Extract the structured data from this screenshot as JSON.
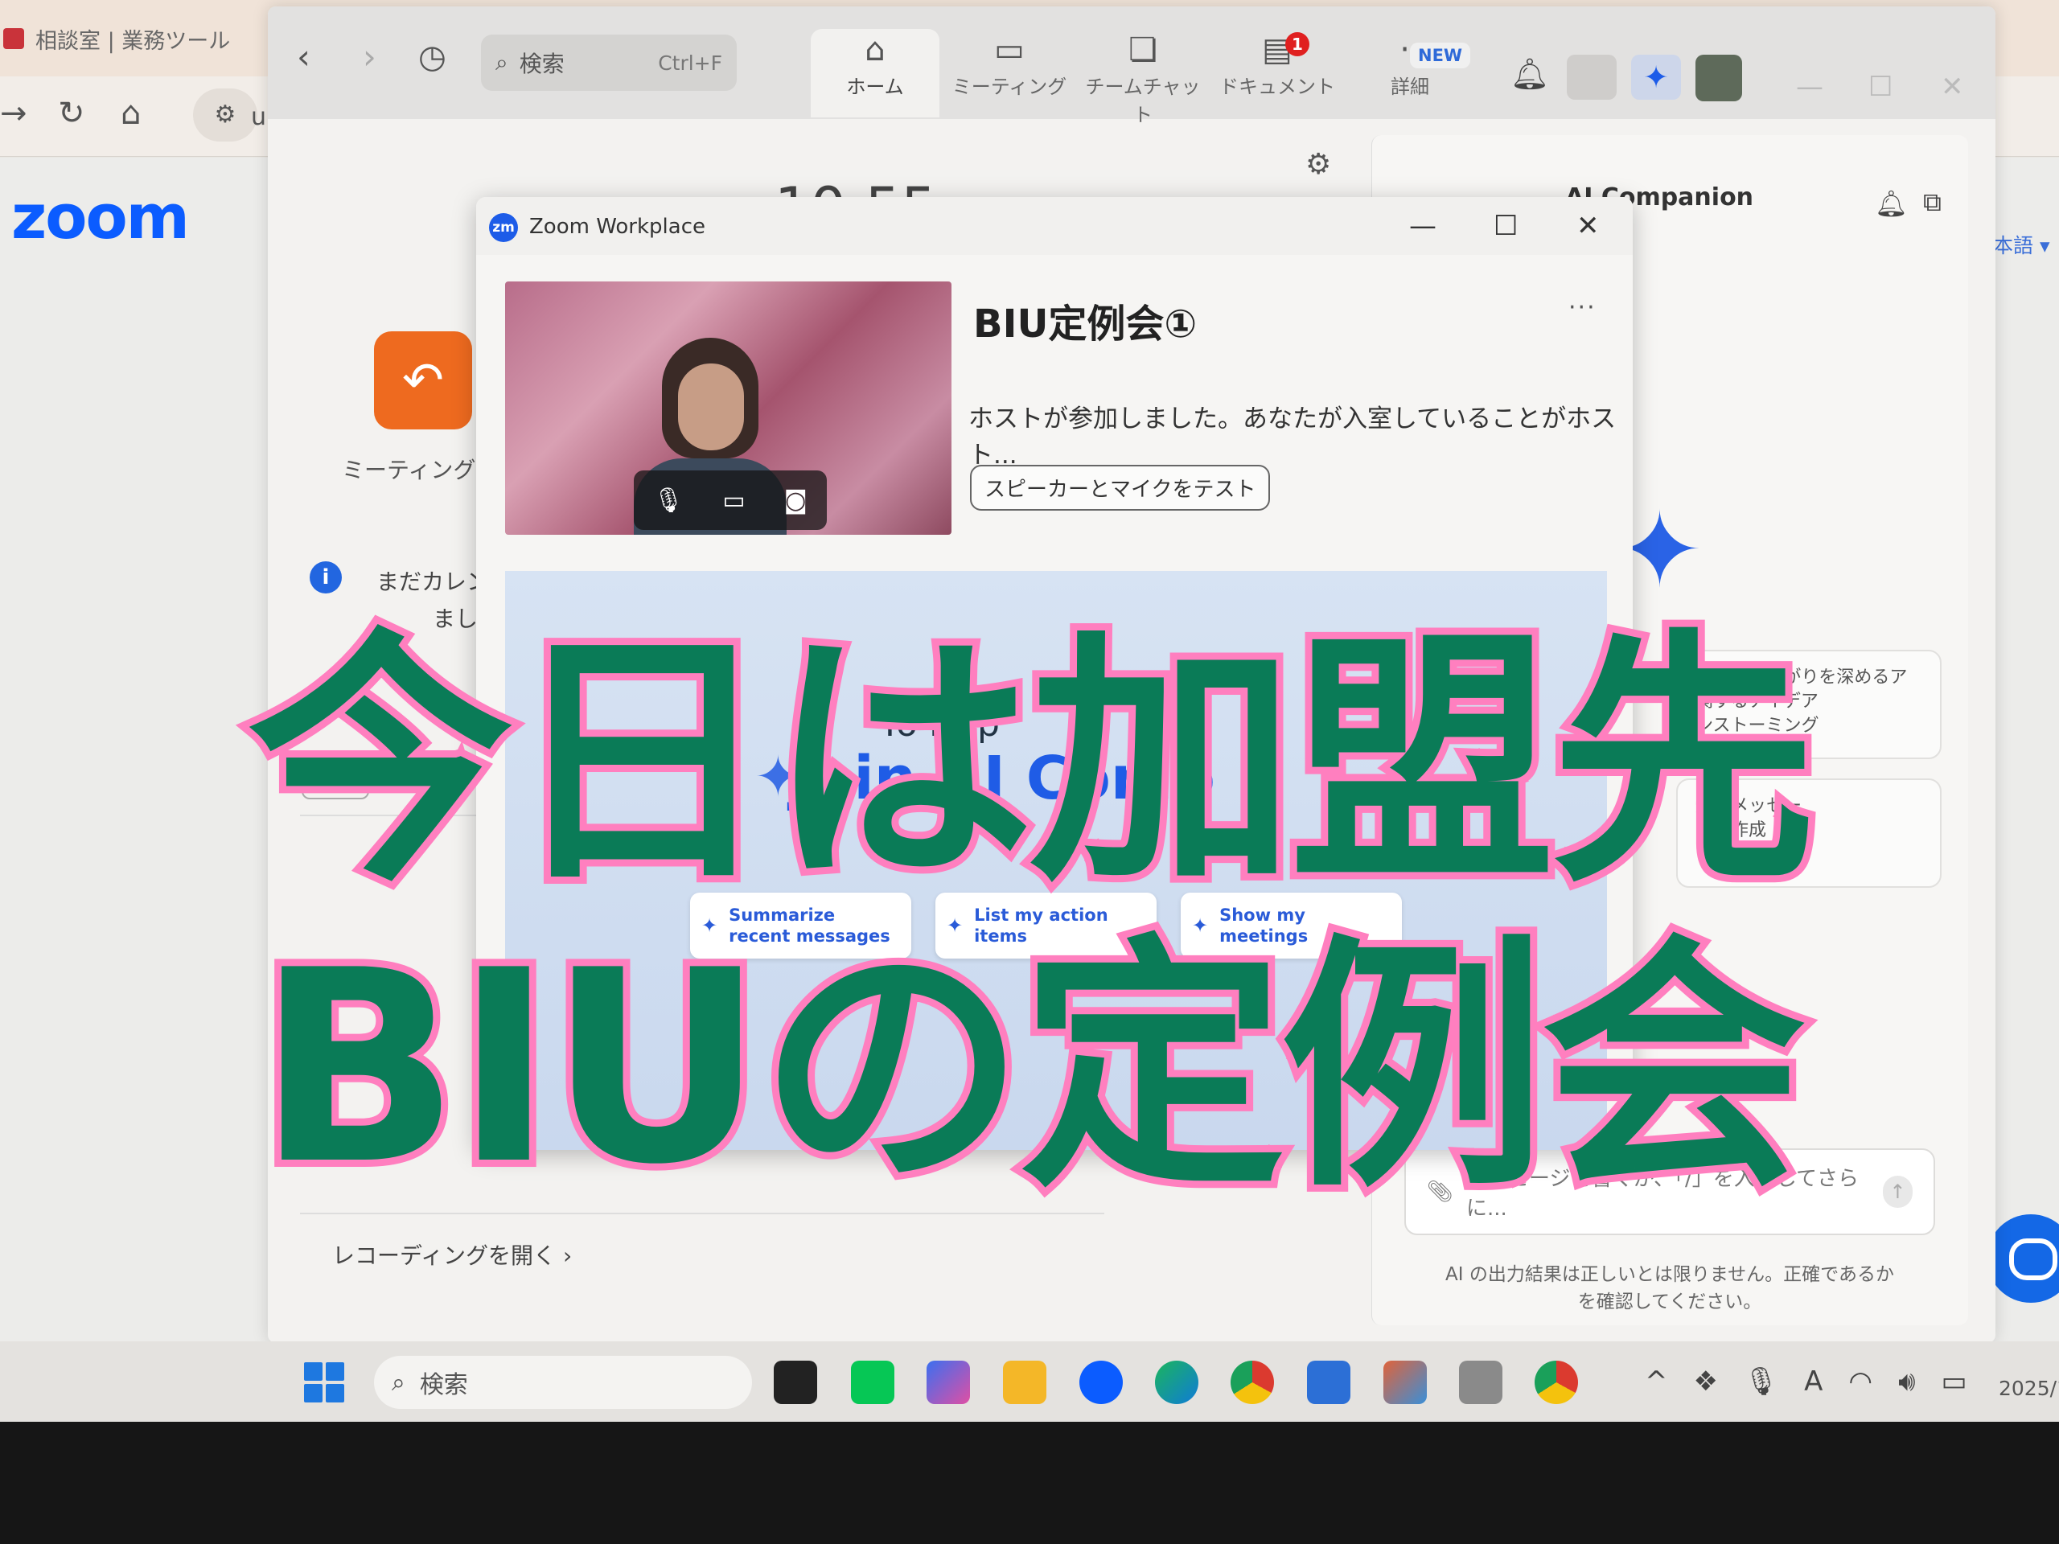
{
  "browser": {
    "tab_title": "相談室 | 業務ツール",
    "url_prefix": "u",
    "logo": "zoom",
    "lang_select": "本語 ▾"
  },
  "zoom_app": {
    "search_placeholder": "検索",
    "search_shortcut": "Ctrl+F",
    "nav_tabs": [
      {
        "label": "ホーム",
        "icon": "home-icon"
      },
      {
        "label": "ミーティング",
        "icon": "video-camera-icon"
      },
      {
        "label": "チームチャット",
        "icon": "chat-icon"
      },
      {
        "label": "ドキュメント",
        "icon": "document-icon"
      },
      {
        "label": "詳細",
        "icon": "more-icon"
      }
    ],
    "doc_badge": "1",
    "new_badge": "NEW",
    "meeting_back_label": "ミーティングに戻",
    "info_text": "まだカレン",
    "info_text_2": "まし",
    "today_button": "今日",
    "recording_link": "レコーディングを開く  ›",
    "clock_partial": "10:55"
  },
  "ai_companion": {
    "title": "AI Companion",
    "cards": [
      "ームのつながりを深めるア\n関するアイデア\nンストーミング",
      "短いメッセー\nジを作成"
    ],
    "input_placeholder": "メッセージを書くか、「/」を入力してさらに...",
    "disclaimer": "AI の出力結果は正しいとは限りません。正確であるかを確認してください。"
  },
  "popup": {
    "window_title": "Zoom Workplace",
    "logo_text": "zm",
    "meeting_title": "BIU定例会①",
    "host_status": "ホストが参加しました。あなたが入室していることがホスト...",
    "test_button": "スピーカーとマイクをテスト",
    "promo_text": "Yo  Hap",
    "promo_heading": "Join AI Comp",
    "chips": [
      "Summarize recent messages",
      "List my action items",
      "Show my meetings"
    ]
  },
  "taskbar": {
    "search_placeholder": "検索",
    "date_partial": "2025/1"
  },
  "overlay": {
    "line1": "今日は加盟先",
    "line2": "BIUの定例会"
  },
  "colors": {
    "caption_fill": "#0a7b57",
    "caption_outline": "#ff7fbf",
    "zoom_blue": "#0b5cff",
    "meeting_orange": "#ee6a1f"
  }
}
